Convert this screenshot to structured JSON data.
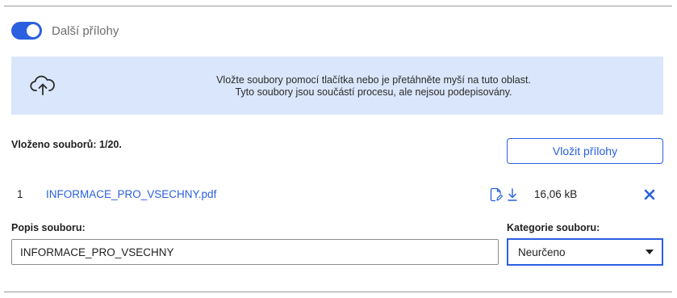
{
  "attachments_toggle": {
    "label": "Další přílohy",
    "state": "on"
  },
  "dropzone": {
    "icon": "cloud-upload-icon",
    "line1": "Vložte soubory pomocí tlačítka nebo je přetáhněte myší na tuto oblast.",
    "line2": "Tyto soubory jsou součástí procesu, ale nejsou podepisovány."
  },
  "uploaded_count": "Vloženo souborů: 1/20.",
  "add_button_label": "Vložit přílohy",
  "files": [
    {
      "index": "1",
      "name": "INFORMACE_PRO_VSECHNY.pdf",
      "size": "16,06 kB",
      "icons": [
        "sign-document-icon",
        "download-icon",
        "remove-icon"
      ]
    }
  ],
  "description_field": {
    "label": "Popis souboru:",
    "value": "INFORMACE_PRO_VSECHNY"
  },
  "category_field": {
    "label": "Kategorie souboru:",
    "selected": "Neurčeno"
  },
  "colors": {
    "accent": "#2a5fe0",
    "dropzone_bg": "#dae6fb",
    "muted_text": "#6d6d6d"
  }
}
